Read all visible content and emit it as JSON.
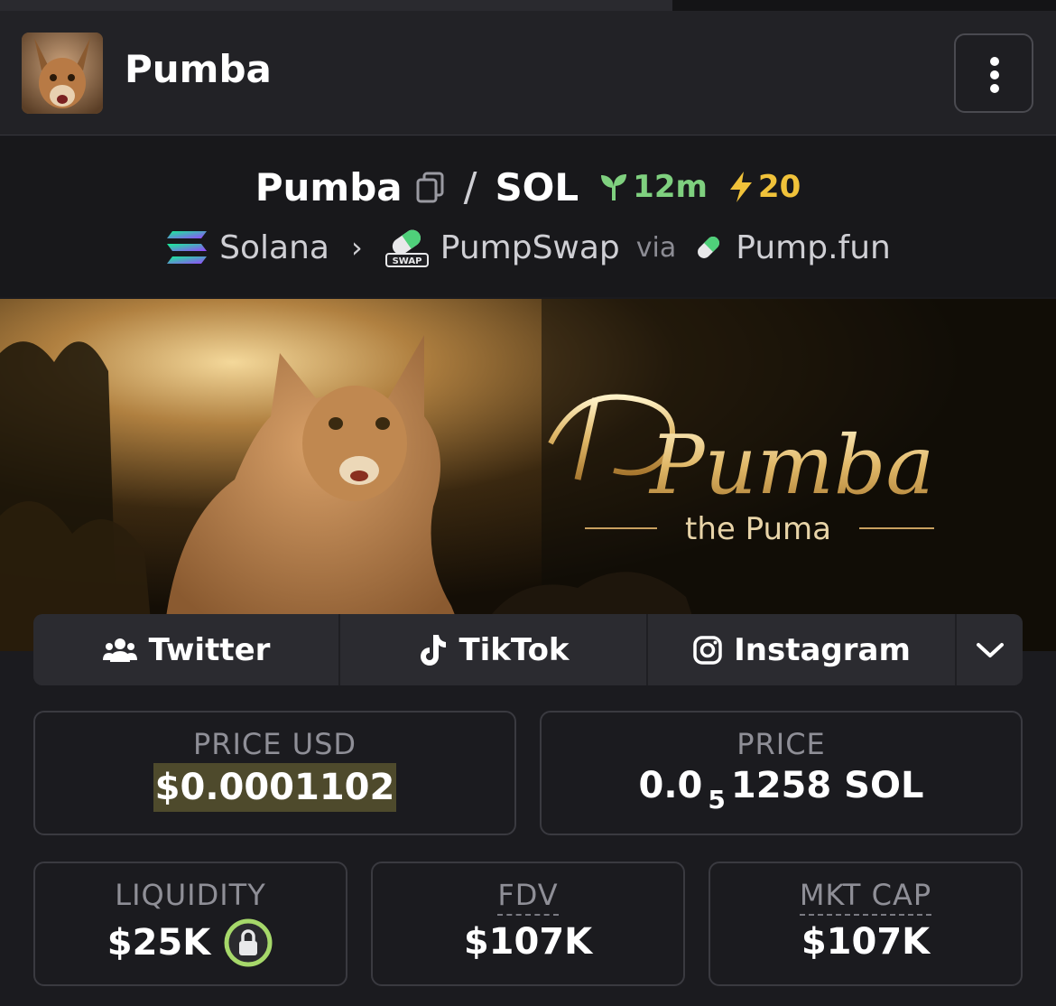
{
  "header": {
    "title": "Pumba"
  },
  "pair": {
    "base": "Pumba",
    "separator": "/",
    "quote": "SOL",
    "age": "12m",
    "boosts": "20",
    "chain": "Solana",
    "dex": "PumpSwap",
    "via": "via",
    "launchpad": "Pump.fun",
    "dex_badge": "SWAP"
  },
  "banner": {
    "title": "Pumba",
    "subtitle": "the Puma"
  },
  "socials": [
    {
      "label": "Twitter"
    },
    {
      "label": "TikTok"
    },
    {
      "label": "Instagram"
    }
  ],
  "stats": {
    "price_usd": {
      "label": "PRICE USD",
      "value": "$0.0001102"
    },
    "price": {
      "label": "PRICE",
      "prefix": "0.0",
      "zeros": "5",
      "digits": "1258",
      "unit": "SOL"
    },
    "liquidity": {
      "label": "LIQUIDITY",
      "value": "$25K"
    },
    "fdv": {
      "label": "FDV",
      "value": "$107K"
    },
    "mkt_cap": {
      "label": "MKT CAP",
      "value": "$107K"
    }
  },
  "colors": {
    "age_green": "#7fd07f",
    "boost_yellow": "#f0c23a",
    "lock_ring": "#a6d86a",
    "price_highlight": "#4e4a2c"
  }
}
